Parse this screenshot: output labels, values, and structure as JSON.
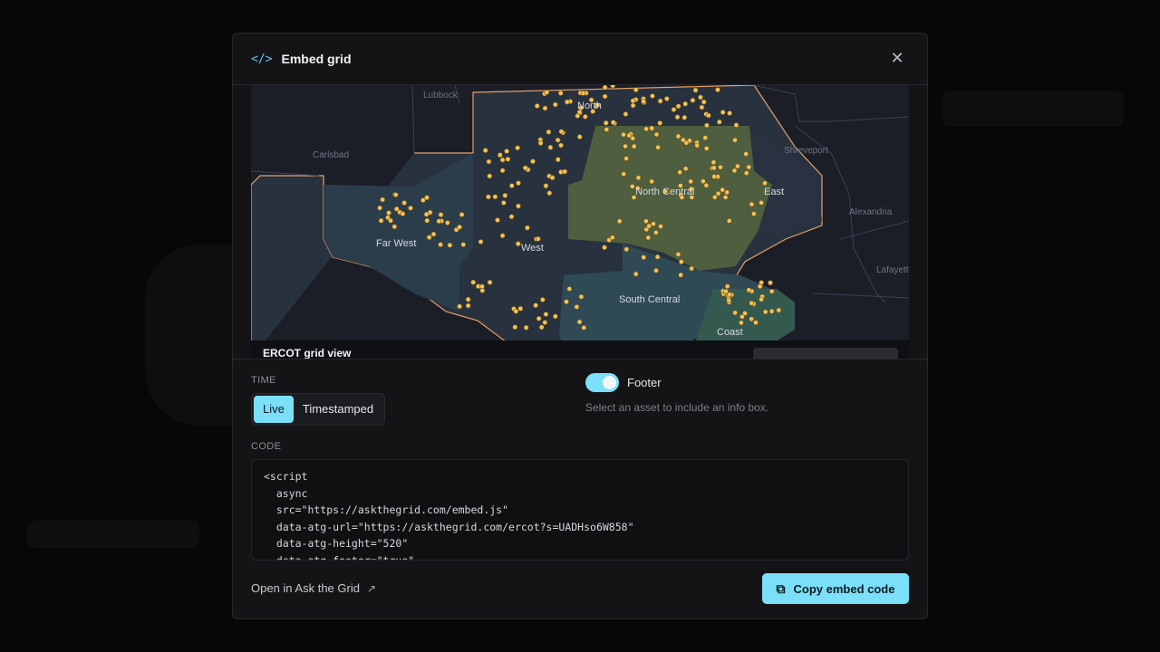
{
  "modal": {
    "title": "Embed grid",
    "close_glyph": "✕"
  },
  "preview": {
    "footer_title": "ERCOT grid view",
    "cities": [
      "Lubbock",
      "Carlsbad",
      "Shreveport",
      "Alexandria",
      "Lafayette"
    ],
    "regions": [
      "North",
      "North Central",
      "East",
      "West",
      "Far West",
      "South Central",
      "Coast"
    ],
    "region_colors": {
      "north_central": "#4e5e3e",
      "south_central": "#2f4a55",
      "far_west": "#26343f",
      "coast": "#345a50"
    },
    "dot_color": "#f2c255"
  },
  "time": {
    "label": "TIME",
    "options": [
      "Live",
      "Timestamped"
    ],
    "selected": "Live"
  },
  "footer_toggle": {
    "label": "Footer",
    "enabled": true,
    "hint": "Select an asset to include an info box."
  },
  "code": {
    "label": "CODE",
    "lines": [
      "<script",
      "  async",
      "  src=\"https://askthegrid.com/embed.js\"",
      "  data-atg-url=\"https://askthegrid.com/ercot?s=UADHso6W858\"",
      "  data-atg-height=\"520\"",
      "  data-atg-footer=\"true\""
    ]
  },
  "actions": {
    "open_link": "Open in Ask the Grid",
    "copy_button": "Copy embed code"
  },
  "colors": {
    "accent": "#7be0f7",
    "background": "#141416"
  },
  "icons": {
    "title": "code-icon",
    "close": "close-icon",
    "open": "external-link-icon",
    "copy": "copy-icon"
  }
}
